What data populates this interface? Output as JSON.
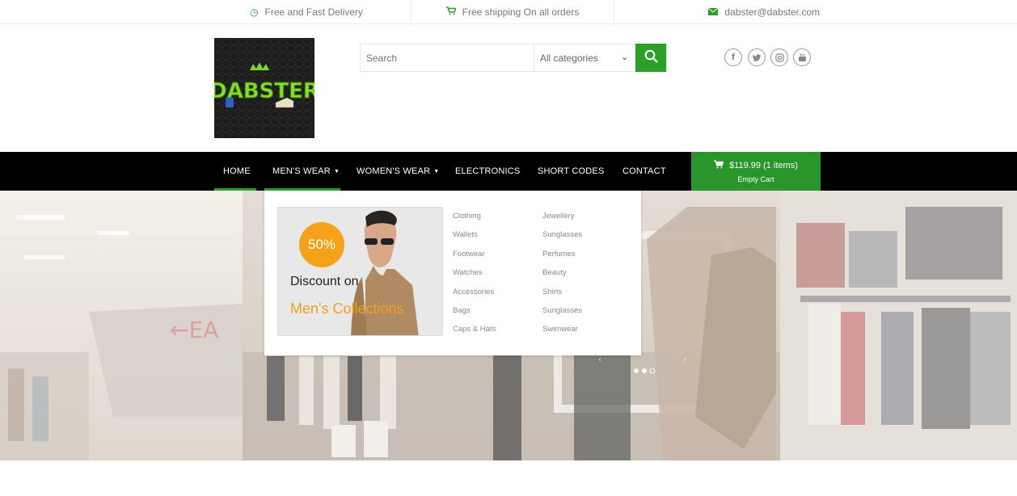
{
  "topbar": {
    "delivery": "Free and Fast Delivery",
    "shipping": "Free shipping On all orders",
    "email": "dabster@dabster.com"
  },
  "logo": {
    "text": "DABSTER"
  },
  "search": {
    "placeholder": "Search",
    "category": "All categories"
  },
  "social": [
    "facebook-icon",
    "twitter-icon",
    "instagram-icon",
    "youtube-icon"
  ],
  "nav": {
    "home": "HOME",
    "mens": "MEN'S WEAR",
    "womens": "WOMEN'S WEAR",
    "electronics": "ELECTRONICS",
    "shortcodes": "SHORT CODES",
    "contact": "CONTACT"
  },
  "cart": {
    "amount": "$119.99 (1 items)",
    "empty": "Empty Cart"
  },
  "dropdown": {
    "promo_percent": "50%",
    "promo_line1": "Discount on",
    "promo_line2": "Men's Collections",
    "col1": [
      "Clothing",
      "Wallets",
      "Footwear",
      "Watches",
      "Accessories",
      "Bags",
      "Caps & Hats"
    ],
    "col2": [
      "Jewellery",
      "Sunglasses",
      "Perfumes",
      "Beauty",
      "Shirts",
      "Sunglasses",
      "Swimwear"
    ]
  },
  "colors": {
    "accent": "#2aa02a",
    "nav_bg": "#000000",
    "promo_orange": "#f5a21a"
  }
}
